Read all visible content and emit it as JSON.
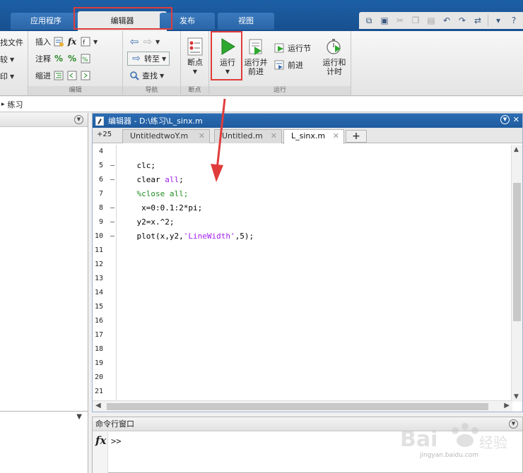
{
  "tabs": {
    "partial_left": "",
    "app": "应用程序",
    "editor": "编辑器",
    "publish": "发布",
    "view": "视图"
  },
  "ribbon": {
    "file_group": {
      "find_files": "找文件",
      "compare": "较",
      "print": "印"
    },
    "edit_group": {
      "insert": "插入",
      "comment": "注释",
      "indent": "缩进",
      "label": "编辑"
    },
    "nav_group": {
      "goto": "转至",
      "find": "查找",
      "label": "导航"
    },
    "breakpoint_group": {
      "breakpoints": "断点",
      "label": "断点"
    },
    "run_group": {
      "run": "运行",
      "run_advance_line1": "运行并",
      "run_advance_line2": "前进",
      "run_section": "运行节",
      "advance": "前进",
      "run_time_line1": "运行和",
      "run_time_line2": "计时",
      "label": "运行"
    }
  },
  "breadcrumb": {
    "folder": "练习"
  },
  "editor": {
    "title": "编辑器 - D:\\练习\\L_sinx.m",
    "zoom": "+25",
    "tabs": [
      {
        "label": "UntitledtwoY.m"
      },
      {
        "label": "Untitled.m"
      },
      {
        "label": "L_sinx.m"
      }
    ],
    "line_numbers": [
      "4",
      "5",
      "6",
      "7",
      "8",
      "9",
      "10",
      "11",
      "12",
      "13",
      "14",
      "15",
      "16",
      "17",
      "18",
      "19",
      "20",
      "21"
    ],
    "dashes": [
      "",
      "–",
      "–",
      "",
      "–",
      "–",
      "–",
      "",
      "",
      "",
      "",
      "",
      "",
      "",
      "",
      "",
      "",
      ""
    ],
    "code": {
      "l5": "clc;",
      "l6_a": "clear ",
      "l6_b": "all",
      "l6_c": ";",
      "l7": "%close all;",
      "l8": " x=0:0.1:2*pi;",
      "l9": "y2=x.^2;",
      "l10_a": "plot(x,y2,",
      "l10_b": "'LineWidth'",
      "l10_c": ",5);"
    }
  },
  "command_window": {
    "title": "命令行窗口",
    "fx": "fx",
    "prompt": ">>"
  },
  "colors": {
    "title_blue": "#1f5b9e",
    "highlight_red": "#e03c3c",
    "run_green": "#2fa82f",
    "keyword_purple": "#a020f0",
    "comment_green": "#228b22"
  },
  "watermark": {
    "brand": "Bai 经验",
    "url": "jingyan.baidu.com"
  }
}
